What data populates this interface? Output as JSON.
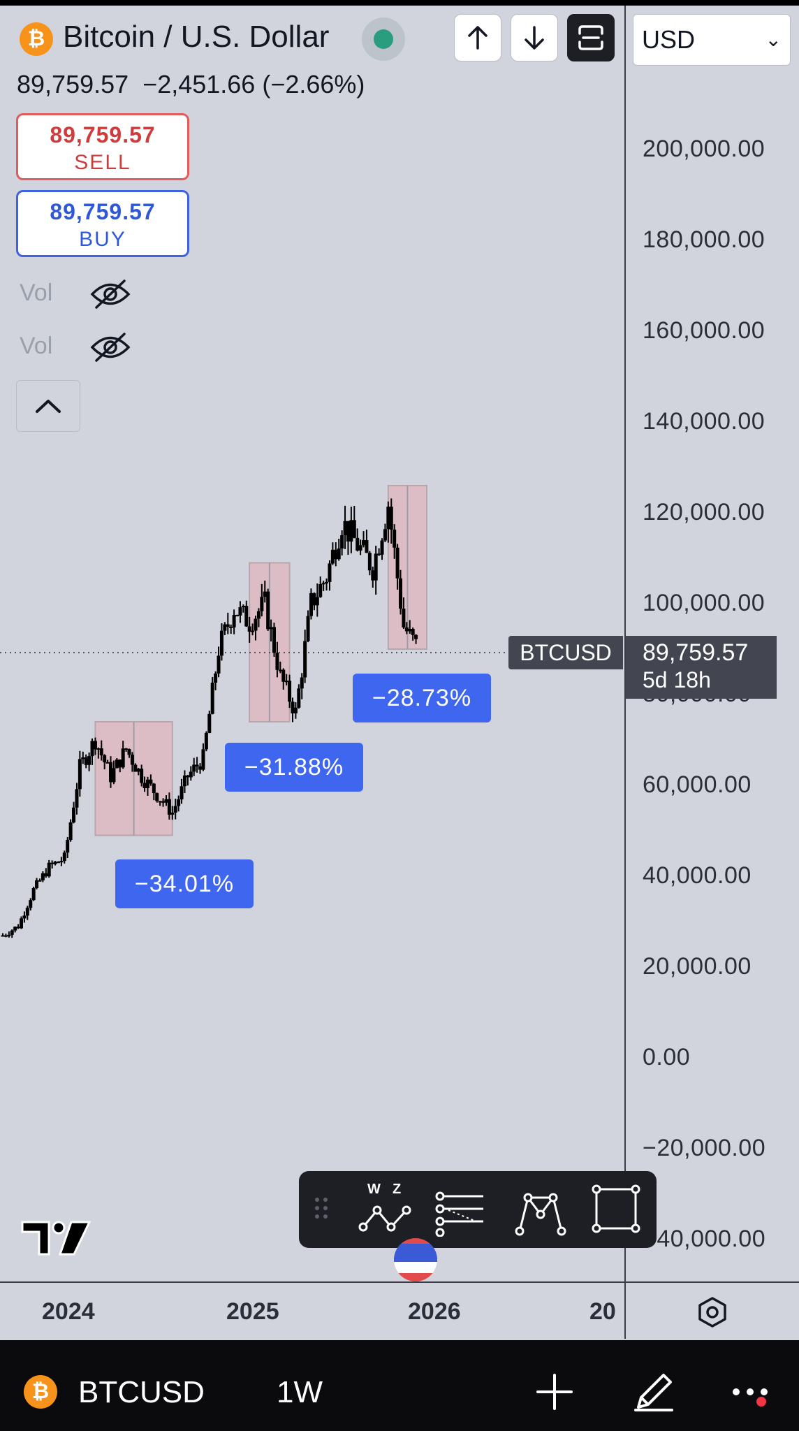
{
  "header": {
    "coin_glyph": "₿",
    "title": "Bitcoin / U.S. Dollar",
    "status_color": "#2a9d7e",
    "last_price": "89,759.57",
    "change": "−2,451.66",
    "change_pct": "(−2.66%)",
    "currency": "USD",
    "toolbar_icons": [
      "arrow-up-icon",
      "arrow-down-icon",
      "fullscreen-icon"
    ]
  },
  "trade": {
    "sell_price": "89,759.57",
    "sell_label": "SELL",
    "buy_price": "89,759.57",
    "buy_label": "BUY",
    "sell_color": "#d03b3b",
    "buy_color": "#2f58d8"
  },
  "indicators": [
    {
      "label": "Vol",
      "icon": "eye-hidden-icon"
    },
    {
      "label": "Vol",
      "icon": "eye-hidden-icon"
    }
  ],
  "price_axis": {
    "ticks": [
      "200,000.00",
      "180,000.00",
      "160,000.00",
      "140,000.00",
      "120,000.00",
      "100,000.00",
      "80,000.00",
      "60,000.00",
      "40,000.00",
      "20,000.00",
      "0.00",
      "−20,000.00",
      "−40,000.00"
    ],
    "current_price": "89,759.57",
    "countdown": "5d 18h",
    "symbol_tag": "BTCUSD"
  },
  "time_axis": {
    "ticks": [
      "2024",
      "2025",
      "2026",
      "20"
    ]
  },
  "drawdowns": [
    {
      "label": "−34.01%"
    },
    {
      "label": "−31.88%"
    },
    {
      "label": "−28.73%"
    }
  ],
  "chart_data": {
    "type": "line",
    "x": [
      "2023-10",
      "2023-11",
      "2023-12",
      "2024-01",
      "2024-02",
      "2024-03",
      "2024-04",
      "2024-05",
      "2024-06",
      "2024-07",
      "2024-08",
      "2024-09",
      "2024-10",
      "2024-11",
      "2024-12",
      "2025-01",
      "2025-02",
      "2025-03",
      "2025-04",
      "2025-05",
      "2025-06",
      "2025-07",
      "2025-08",
      "2025-09",
      "2025-10",
      "2025-11",
      "2025-12"
    ],
    "series": [
      {
        "values": [
          27000,
          29000,
          37000,
          42000,
          44000,
          64000,
          70000,
          62000,
          68000,
          62000,
          58000,
          54000,
          62000,
          66000,
          90000,
          99000,
          96000,
          100000,
          84000,
          76000,
          100000,
          106000,
          118000,
          113000,
          108000,
          122000,
          95000,
          89760
        ]
      }
    ],
    "ylim": [
      -40000,
      200000
    ],
    "y_log": false,
    "last_value": 89759.57,
    "grid": false
  },
  "bottom": {
    "symbol": "BTCUSD",
    "interval": "1W"
  }
}
